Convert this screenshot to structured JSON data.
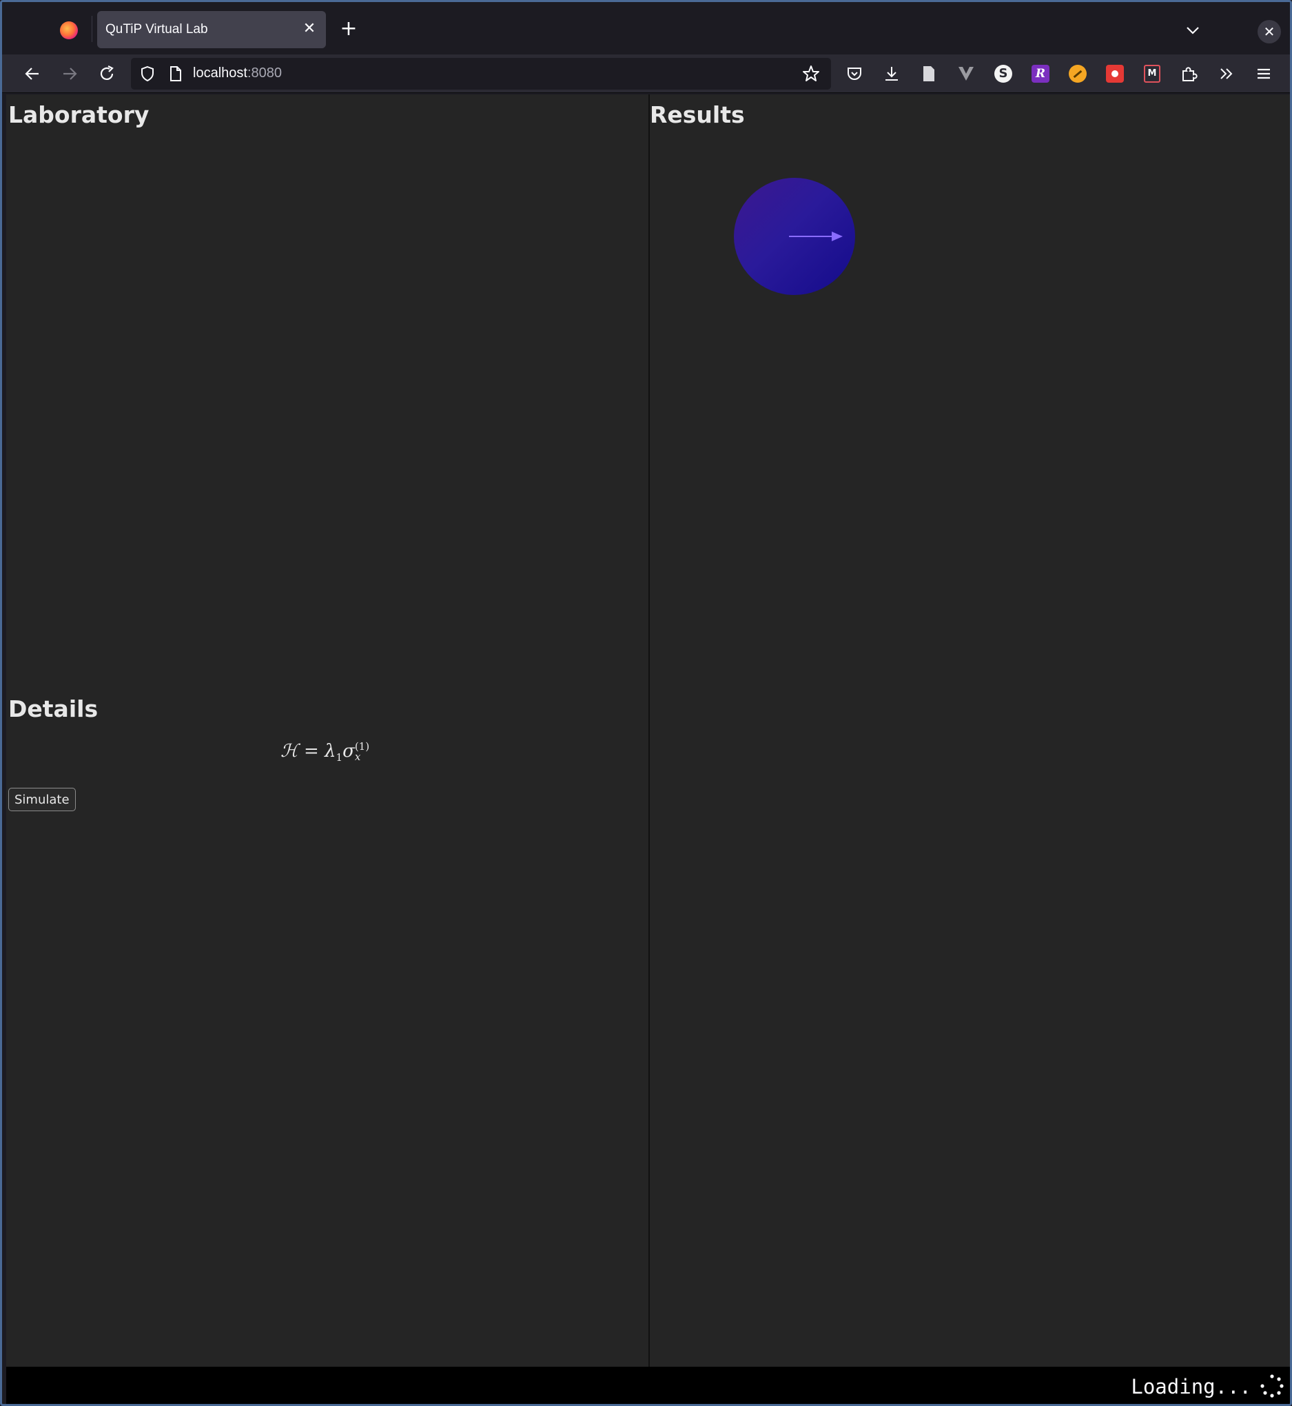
{
  "browser": {
    "tab_title": "QuTiP Virtual Lab",
    "url_host": "localhost",
    "url_port": ":8080",
    "accent": "#4a6a96"
  },
  "icons": {
    "tabstrip": [
      "firefox-logo-icon",
      "close-tab-icon",
      "new-tab-icon",
      "list-all-tabs-icon",
      "close-window-icon"
    ],
    "nav": [
      "back-arrow-icon",
      "forward-arrow-icon",
      "reload-icon",
      "shield-icon",
      "page-icon",
      "bookmark-star-icon"
    ],
    "toolbar": [
      "pocket-icon",
      "download-icon",
      "reader-icon",
      "v-extension-icon",
      "s-extension-icon",
      "r-extension-icon",
      "orange-extension-icon",
      "red-extension-icon",
      "m-extension-icon",
      "extensions-puzzle-icon",
      "overflow-chevrons-icon",
      "hamburger-menu-icon"
    ]
  },
  "page": {
    "laboratory_heading": "Laboratory",
    "details_heading": "Details",
    "results_heading": "Results",
    "formula": {
      "lhs": "ℋ",
      "eq": "=",
      "lambda": "λ",
      "lambda_sub": "1",
      "sigma": "σ",
      "sigma_sub": "x",
      "sigma_sup": "(1)"
    },
    "simulate_label": "Simulate",
    "bloch_colors": {
      "sphere": "#2a1a9a",
      "vector": "#8a6cff"
    }
  },
  "status": {
    "loading_text": "Loading..."
  }
}
